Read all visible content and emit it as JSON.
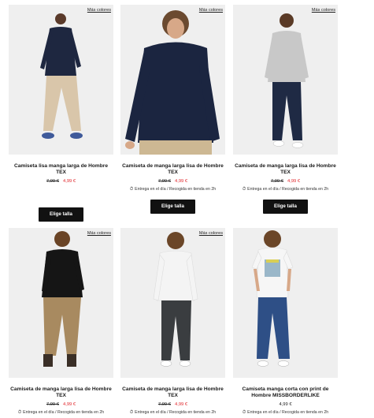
{
  "products": [
    {
      "more_colors": "Más colores",
      "title": "Camiseta lisa manga larga de Hombre TEX",
      "old_price": "7,99 €",
      "price": "4,99 €",
      "delivery": "",
      "button": "Elige talla",
      "image": "model-navy-sweater-beige-pants-icon"
    },
    {
      "more_colors": "Más colores",
      "title": "Camiseta de manga larga lisa de Hombre TEX",
      "old_price": "7,99 €",
      "price": "4,99 €",
      "delivery": "Entrega en el día / Recogida en tienda en 2h",
      "button": "Elige talla",
      "image": "model-navy-sweater-closeup-icon"
    },
    {
      "more_colors": "Más colores",
      "title": "Camiseta de manga larga lisa de Hombre TEX",
      "old_price": "7,99 €",
      "price": "4,99 €",
      "delivery": "Entrega en el día / Recogida en tienda en 2h",
      "button": "Elige talla",
      "image": "model-grey-sweater-navy-pants-icon"
    },
    {
      "more_colors": "Más colores",
      "title": "Camiseta de manga larga lisa de Hombre TEX",
      "old_price": "7,99 €",
      "price": "4,99 €",
      "delivery": "Entrega en el día / Recogida en tienda en 2h",
      "image": "model-black-sweater-khaki-pants-icon"
    },
    {
      "more_colors": "Más colores",
      "title": "Camiseta de manga larga lisa de Hombre TEX",
      "old_price": "7,99 €",
      "price": "4,99 €",
      "delivery": "Entrega en el día / Recogida en tienda en 2h",
      "image": "model-white-sweater-dark-jeans-icon"
    },
    {
      "title": "Camiseta manga corta con print de Hombre MISSBORDERLIKE",
      "price": "4,99 €",
      "delivery": "Entrega en el día / Recogida en tienda en 2h",
      "image": "model-white-print-tee-blue-jeans-icon"
    }
  ],
  "colors": {
    "sale_red": "#e0262b",
    "button_bg": "#111111",
    "image_bg": "#efefef"
  }
}
